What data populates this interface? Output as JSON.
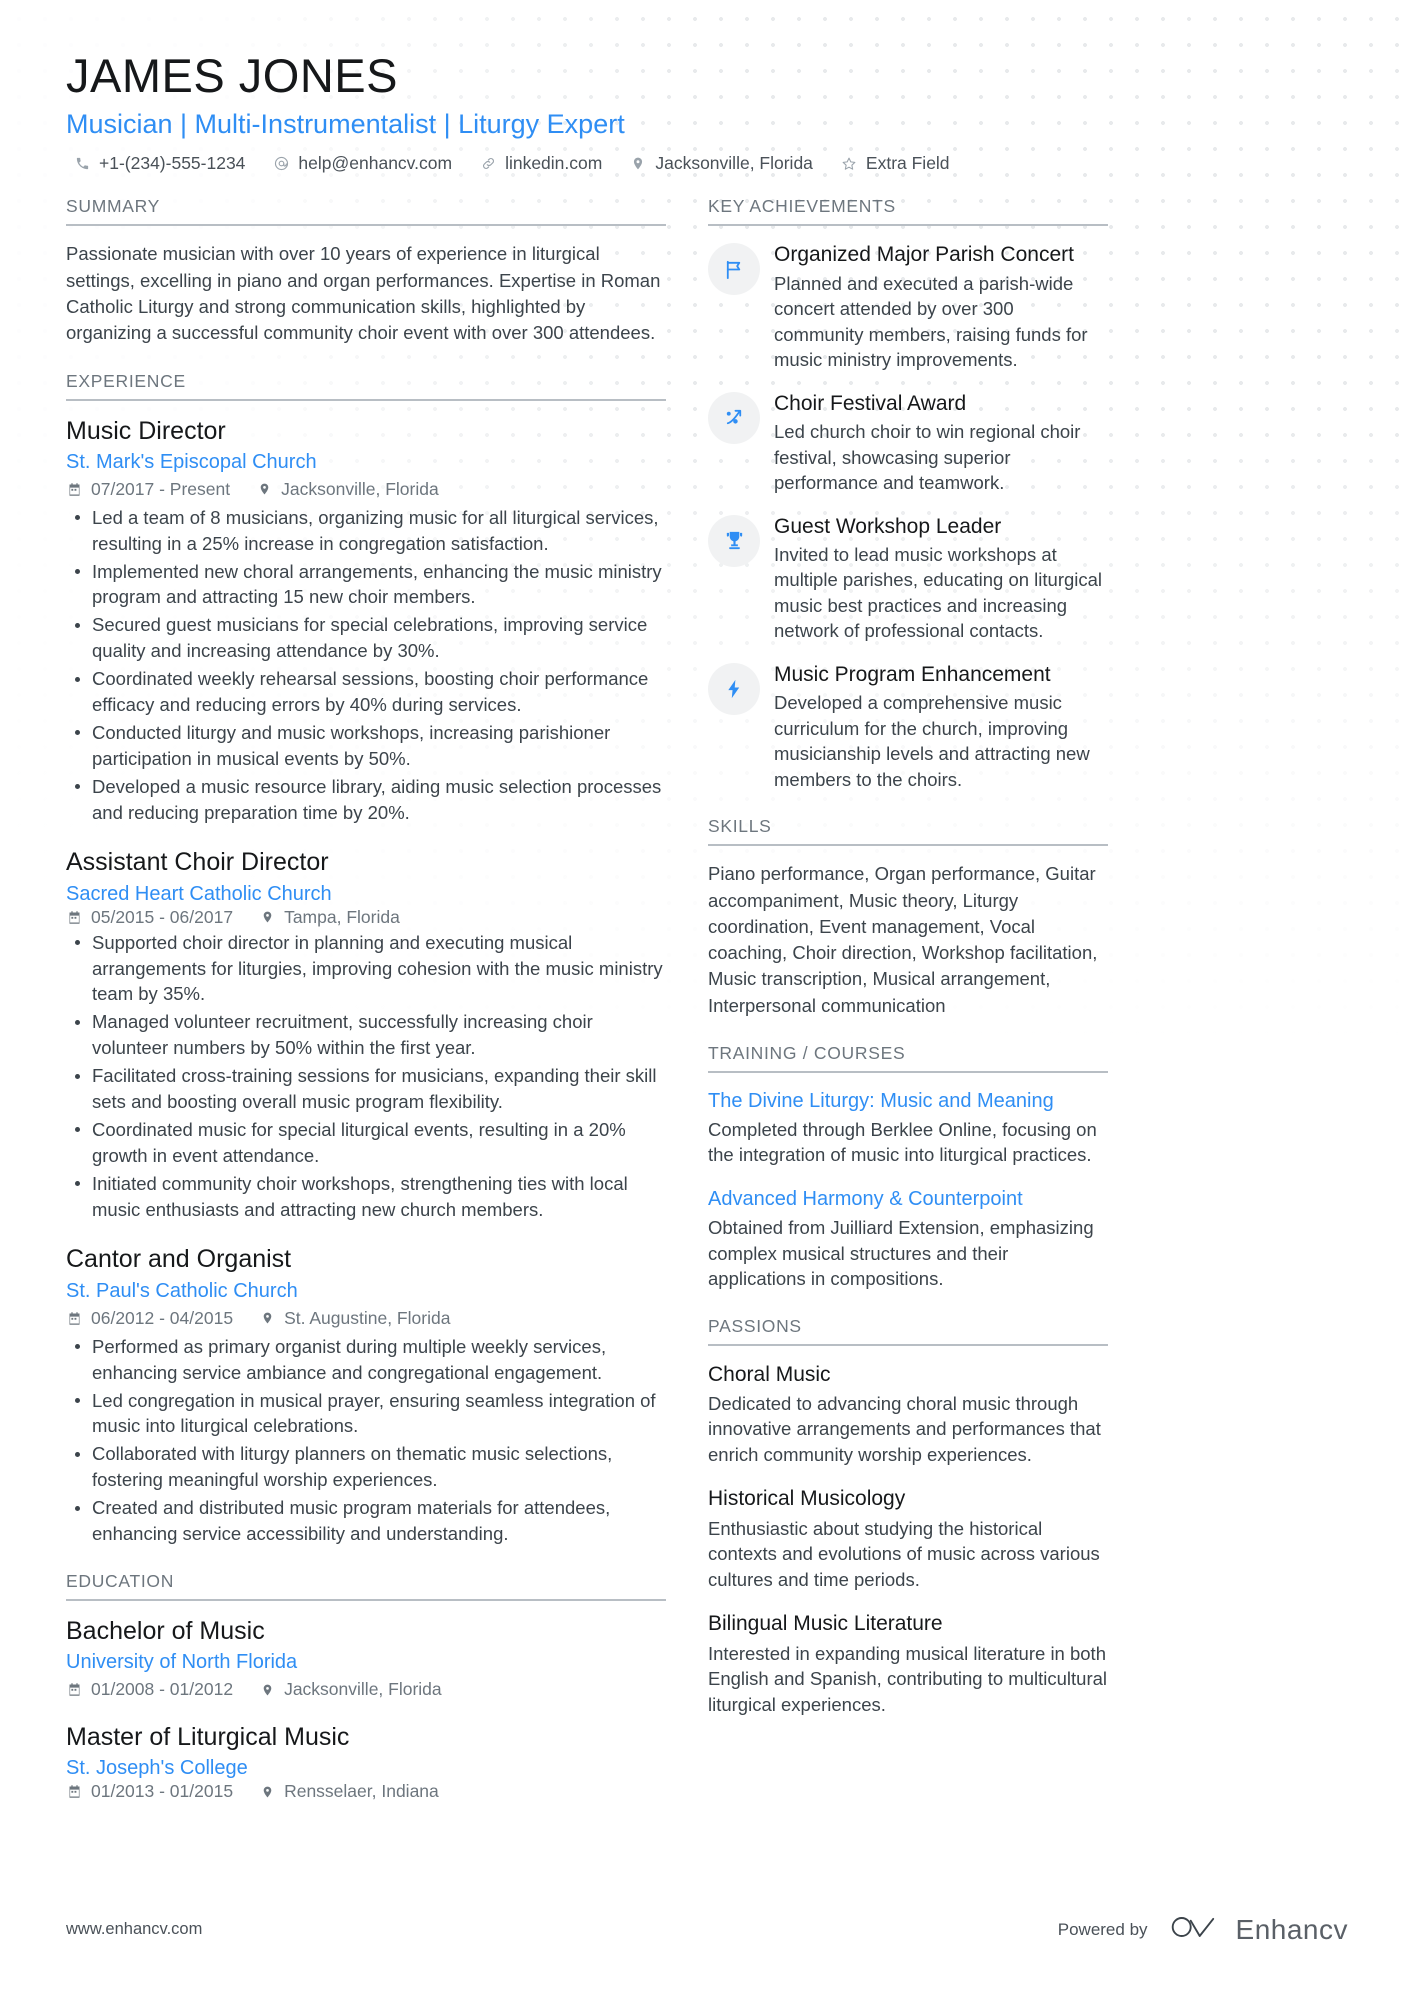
{
  "header": {
    "name": "JAMES JONES",
    "headline": "Musician | Multi-Instrumentalist | Liturgy Expert",
    "contacts": [
      {
        "icon": "phone-icon",
        "text": "+1-(234)-555-1234"
      },
      {
        "icon": "email-icon",
        "text": "help@enhancv.com"
      },
      {
        "icon": "link-icon",
        "text": "linkedin.com"
      },
      {
        "icon": "location-icon",
        "text": "Jacksonville, Florida"
      },
      {
        "icon": "star-icon",
        "text": "Extra Field"
      }
    ]
  },
  "summary": {
    "title": "SUMMARY",
    "text": "Passionate musician with over 10 years of experience in liturgical settings, excelling in piano and organ performances. Expertise in Roman Catholic Liturgy and strong communication skills, highlighted by organizing a successful community choir event with over 300 attendees."
  },
  "experience": {
    "title": "EXPERIENCE",
    "jobs": [
      {
        "title": "Music Director",
        "org": "St. Mark's Episcopal Church",
        "dates": "07/2017 - Present",
        "location": "Jacksonville, Florida",
        "inline_meta": false,
        "bullets": [
          "Led a team of 8 musicians, organizing music for all liturgical services, resulting in a 25% increase in congregation satisfaction.",
          "Implemented new choral arrangements, enhancing the music ministry program and attracting 15 new choir members.",
          "Secured guest musicians for special celebrations, improving service quality and increasing attendance by 30%.",
          "Coordinated weekly rehearsal sessions, boosting choir performance efficacy and reducing errors by 40% during services.",
          "Conducted liturgy and music workshops, increasing parishioner participation in musical events by 50%.",
          "Developed a music resource library, aiding music selection processes and reducing preparation time by 20%."
        ]
      },
      {
        "title": "Assistant Choir Director",
        "org": "Sacred Heart Catholic Church",
        "dates": "05/2015 - 06/2017",
        "location": "Tampa, Florida",
        "inline_meta": true,
        "bullets": [
          "Supported choir director in planning and executing musical arrangements for liturgies, improving cohesion with the music ministry team by 35%.",
          "Managed volunteer recruitment, successfully increasing choir volunteer numbers by 50% within the first year.",
          "Facilitated cross-training sessions for musicians, expanding their skill sets and boosting overall music program flexibility.",
          "Coordinated music for special liturgical events, resulting in a 20% growth in event attendance.",
          "Initiated community choir workshops, strengthening ties with local music enthusiasts and attracting new church members."
        ]
      },
      {
        "title": "Cantor and Organist",
        "org": "St. Paul's Catholic Church",
        "dates": "06/2012 - 04/2015",
        "location": "St. Augustine, Florida",
        "inline_meta": false,
        "bullets": [
          "Performed as primary organist during multiple weekly services, enhancing service ambiance and congregational engagement.",
          "Led congregation in musical prayer, ensuring seamless integration of music into liturgical celebrations.",
          "Collaborated with liturgy planners on thematic music selections, fostering meaningful worship experiences.",
          "Created and distributed music program materials for attendees, enhancing service accessibility and understanding."
        ]
      }
    ]
  },
  "education": {
    "title": "EDUCATION",
    "entries": [
      {
        "title": "Bachelor of Music",
        "org": "University of North Florida",
        "dates": "01/2008 - 01/2012",
        "location": "Jacksonville, Florida",
        "inline_meta": false
      },
      {
        "title": "Master of Liturgical Music",
        "org": "St. Joseph's College",
        "dates": "01/2013 - 01/2015",
        "location": "Rensselaer, Indiana",
        "inline_meta": true
      }
    ]
  },
  "achievements": {
    "title": "KEY ACHIEVEMENTS",
    "items": [
      {
        "icon": "flag-icon",
        "title": "Organized Major Parish Concert",
        "desc": "Planned and executed a parish-wide concert attended by over 300 community members, raising funds for music ministry improvements."
      },
      {
        "icon": "trending-up-icon",
        "title": "Choir Festival Award",
        "desc": "Led church choir to win regional choir festival, showcasing superior performance and teamwork."
      },
      {
        "icon": "trophy-icon",
        "title": "Guest Workshop Leader",
        "desc": "Invited to lead music workshops at multiple parishes, educating on liturgical music best practices and increasing network of professional contacts."
      },
      {
        "icon": "lightning-icon",
        "title": "Music Program Enhancement",
        "desc": "Developed a comprehensive music curriculum for the church, improving musicianship levels and attracting new members to the choirs."
      }
    ]
  },
  "skills": {
    "title": "SKILLS",
    "text": "Piano performance, Organ performance, Guitar accompaniment, Music theory, Liturgy coordination, Event management, Vocal coaching, Choir direction, Workshop facilitation, Music transcription, Musical arrangement, Interpersonal communication"
  },
  "training": {
    "title": "TRAINING / COURSES",
    "entries": [
      {
        "title": "The Divine Liturgy: Music and Meaning",
        "desc": "Completed through Berklee Online, focusing on the integration of music into liturgical practices."
      },
      {
        "title": "Advanced Harmony & Counterpoint",
        "desc": "Obtained from Juilliard Extension, emphasizing complex musical structures and their applications in compositions."
      }
    ]
  },
  "passions": {
    "title": "PASSIONS",
    "entries": [
      {
        "title": "Choral Music",
        "desc": "Dedicated to advancing choral music through innovative arrangements and performances that enrich community worship experiences."
      },
      {
        "title": "Historical Musicology",
        "desc": "Enthusiastic about studying the historical contexts and evolutions of music across various cultures and time periods."
      },
      {
        "title": "Bilingual Music Literature",
        "desc": "Interested in expanding musical literature in both English and Spanish, contributing to multicultural liturgical experiences."
      }
    ]
  },
  "footer": {
    "url": "www.enhancv.com",
    "powered_by": "Powered by",
    "brand": "Enhancv"
  },
  "colors": {
    "accent": "#2f8ef4",
    "text": "#3c444b",
    "muted": "#6d767e",
    "heading": "#16181a"
  }
}
